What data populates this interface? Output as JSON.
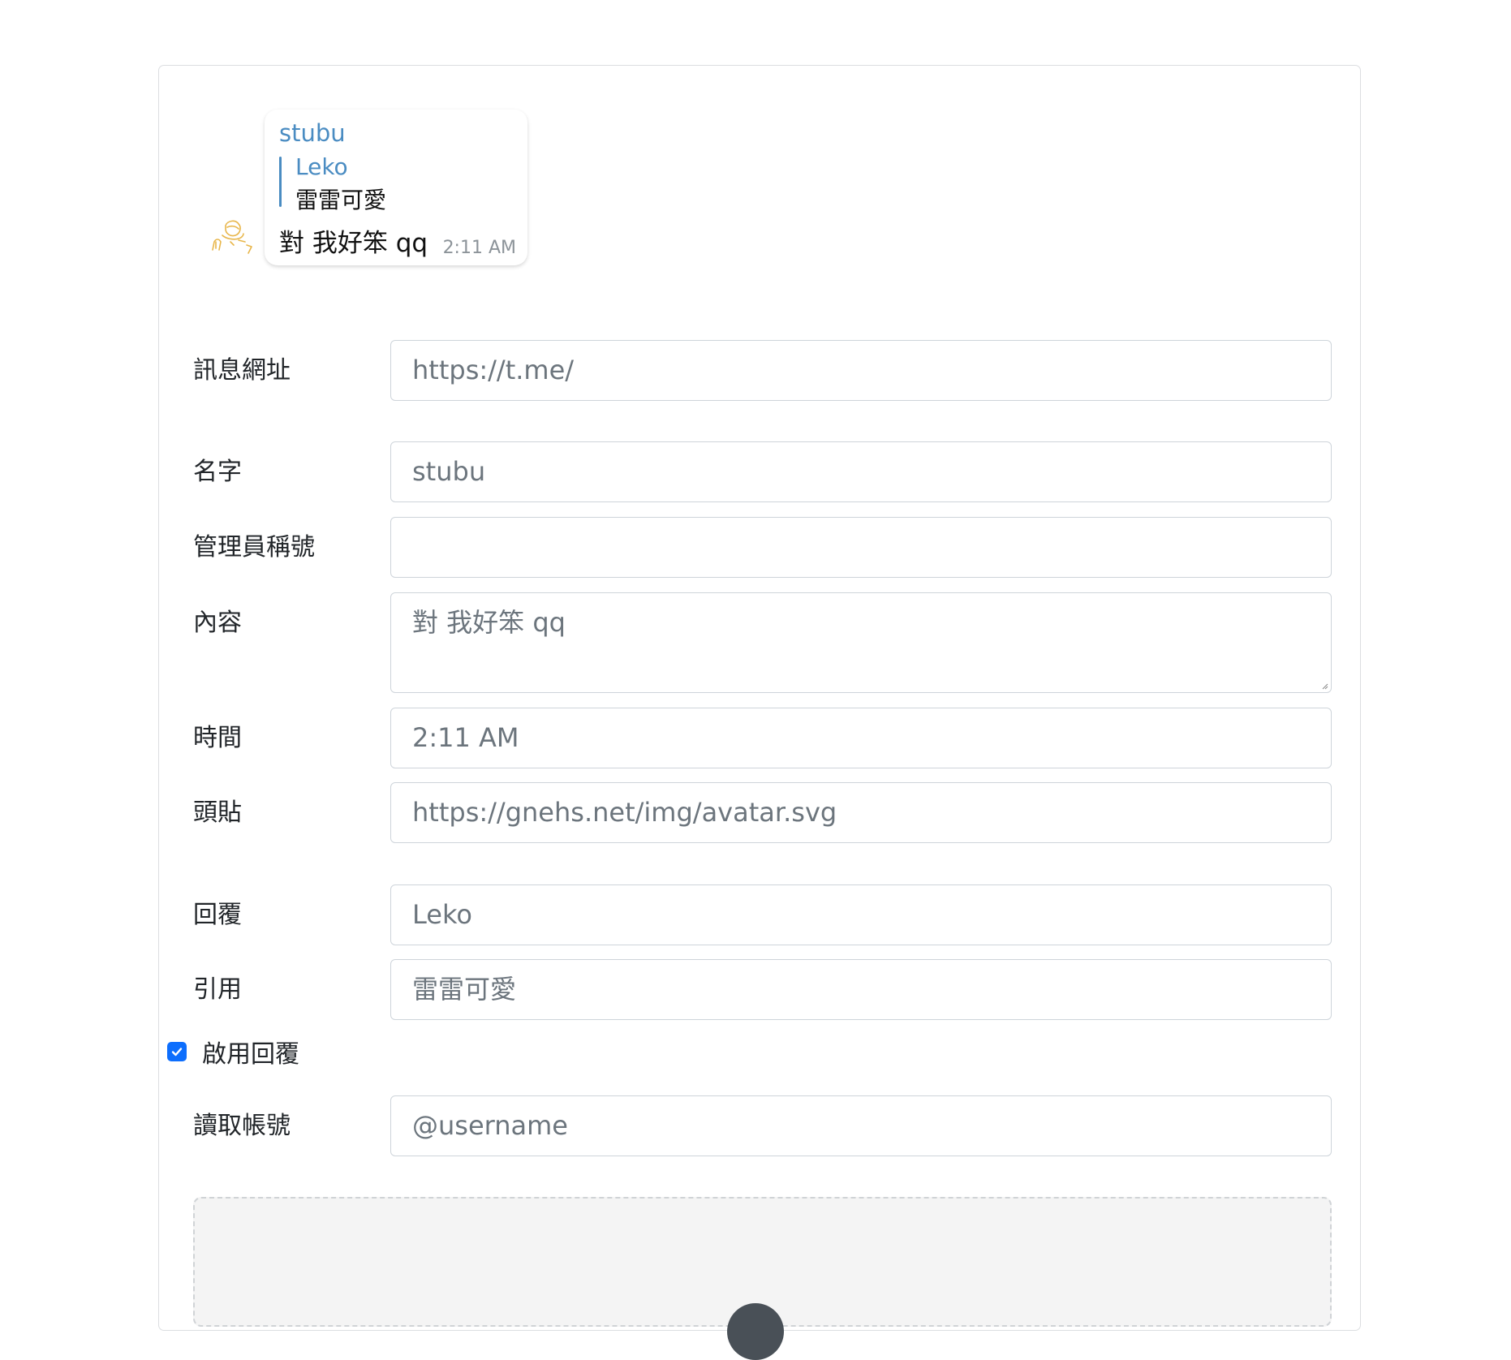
{
  "preview": {
    "sender": "stubu",
    "reply_name": "Leko",
    "reply_text": "雷雷可愛",
    "message": "對 我好笨 qq",
    "time": "2:11 AM",
    "avatar_icon": "sketch-avatar-icon"
  },
  "form": {
    "message_url": {
      "label": "訊息網址",
      "placeholder": "https://t.me/",
      "value": ""
    },
    "name": {
      "label": "名字",
      "value": "stubu"
    },
    "admin_title": {
      "label": "管理員稱號",
      "value": ""
    },
    "content": {
      "label": "內容",
      "value": "對 我好笨 qq"
    },
    "time": {
      "label": "時間",
      "value": "2:11 AM"
    },
    "avatar": {
      "label": "頭貼",
      "value": "https://gnehs.net/img/avatar.svg"
    },
    "reply": {
      "label": "回覆",
      "value": "Leko"
    },
    "quote": {
      "label": "引用",
      "value": "雷雷可愛"
    },
    "enable_reply": {
      "label": "啟用回覆",
      "checked": true
    },
    "read_account": {
      "label": "讀取帳號",
      "placeholder": "@username",
      "value": ""
    }
  },
  "colors": {
    "accent": "#0d6efd",
    "sender_blue": "#4a8cc2",
    "border": "#ced4da",
    "avatar_sketch": "#e8b64a"
  }
}
